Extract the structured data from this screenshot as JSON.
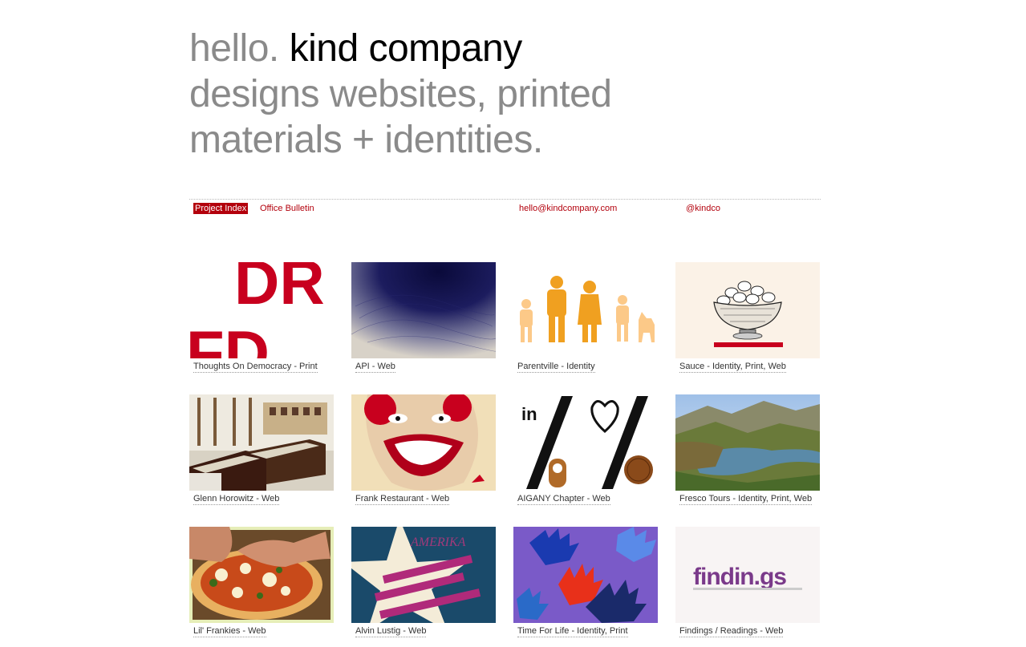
{
  "hero": {
    "greeting": "hello.",
    "brand": "kind company",
    "line2": "designs websites, printed",
    "line3": "materials + identities."
  },
  "nav": {
    "project_index": "Project Index",
    "office_bulletin": "Office Bulletin",
    "email": "hello@kindcompany.com",
    "twitter": "@kindco"
  },
  "colors": {
    "accent": "#b3000c",
    "hero_text": "#8a8a8a",
    "brand_text": "#000000"
  },
  "projects": [
    {
      "caption": "Thoughts On Democracy - Print",
      "thumb": "drfd-red-type-thumbnail"
    },
    {
      "caption": "API - Web",
      "thumb": "blue-ink-scribble-thumbnail"
    },
    {
      "caption": "Parentville - Identity",
      "thumb": "orange-family-figures-thumbnail"
    },
    {
      "caption": "Sauce - Identity, Print, Web",
      "thumb": "bowl-engraving-thumbnail"
    },
    {
      "caption": "Glenn Horowitz - Web",
      "thumb": "bookstore-display-thumbnail"
    },
    {
      "caption": "Frank Restaurant - Web",
      "thumb": "clown-face-thumbnail"
    },
    {
      "caption": "AIGANY Chapter - Web",
      "thumb": "in-heart-percent-thumbnail"
    },
    {
      "caption": "Fresco Tours - Identity, Print, Web",
      "thumb": "mountain-lake-thumbnail"
    },
    {
      "caption": "Lil' Frankies - Web",
      "thumb": "pizza-hands-thumbnail"
    },
    {
      "caption": "Alvin Lustig - Web",
      "thumb": "amerika-star-stripes-thumbnail"
    },
    {
      "caption": "Time For Life - Identity, Print",
      "thumb": "painted-hands-thumbnail"
    },
    {
      "caption": "Findings / Readings - Web",
      "thumb": "findings-logo-thumbnail"
    }
  ],
  "thumb_text": {
    "drfd_top": "DR",
    "drfd_bottom": "FD",
    "aiga_in": "in",
    "amerika": "AMERIKA",
    "findings": "findin.gs"
  }
}
